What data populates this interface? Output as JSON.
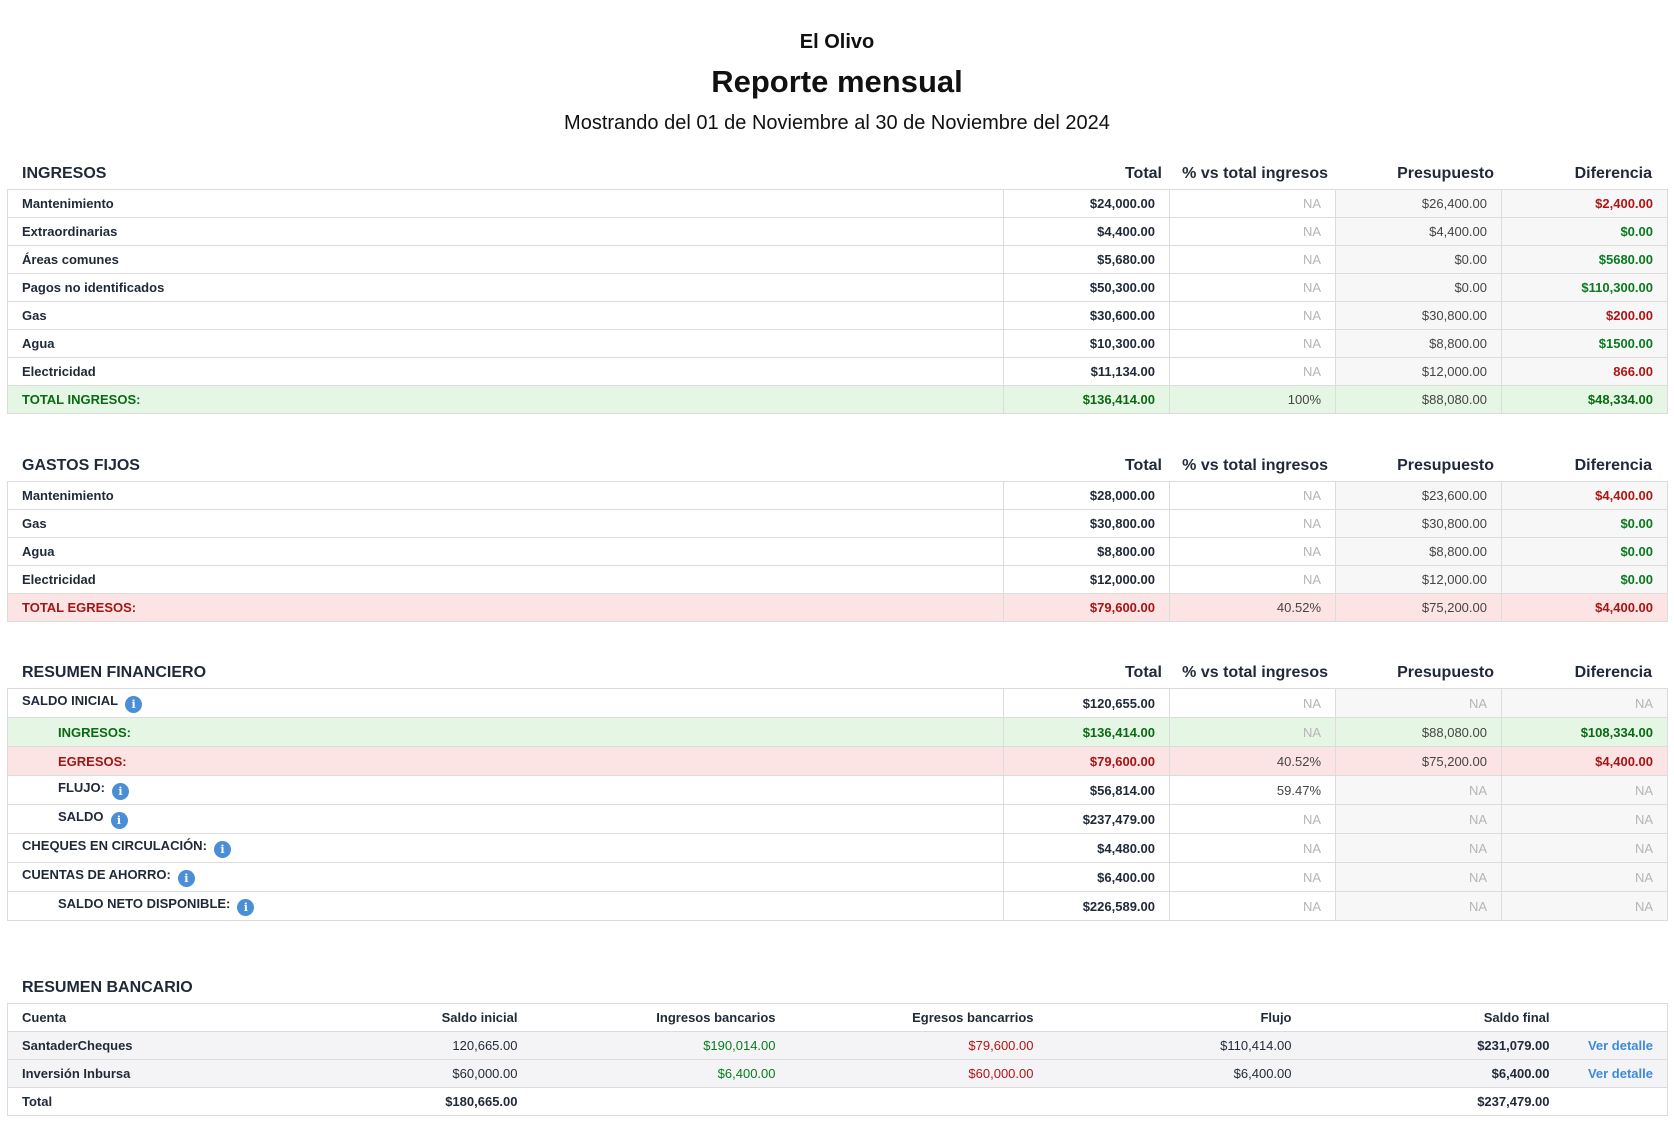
{
  "header": {
    "org": "El Olivo",
    "title": "Reporte mensual",
    "subtitle": "Mostrando del 01 de Noviembre al 30 de Noviembre del 2024"
  },
  "columns": {
    "total": "Total",
    "pct": "% vs total ingresos",
    "presupuesto": "Presupuesto",
    "diferencia": "Diferencia"
  },
  "ingresos": {
    "title": "INGRESOS",
    "rows": [
      {
        "label": "Mantenimiento",
        "total": "$24,000.00",
        "pct": "NA",
        "pres": "$26,400.00",
        "diff": "$2,400.00"
      },
      {
        "label": "Extraordinarias",
        "total": "$4,400.00",
        "pct": "NA",
        "pres": "$4,400.00",
        "diff": "$0.00"
      },
      {
        "label": "Áreas comunes",
        "total": "$5,680.00",
        "pct": "NA",
        "pres": "$0.00",
        "diff": "$5680.00"
      },
      {
        "label": "Pagos no identificados",
        "total": "$50,300.00",
        "pct": "NA",
        "pres": "$0.00",
        "diff": "$110,300.00"
      },
      {
        "label": "Gas",
        "total": "$30,600.00",
        "pct": "NA",
        "pres": "$30,800.00",
        "diff": "$200.00"
      },
      {
        "label": "Agua",
        "total": "$10,300.00",
        "pct": "NA",
        "pres": "$8,800.00",
        "diff": "$1500.00"
      },
      {
        "label": "Electricidad",
        "total": "$11,134.00",
        "pct": "NA",
        "pres": "$12,000.00",
        "diff": "866.00"
      }
    ],
    "total": {
      "label": "TOTAL INGRESOS:",
      "total": "$136,414.00",
      "pct": "100%",
      "pres": "$88,080.00",
      "diff": "$48,334.00"
    }
  },
  "gastos": {
    "title": "GASTOS FIJOS",
    "rows": [
      {
        "label": "Mantenimiento",
        "total": "$28,000.00",
        "pct": "NA",
        "pres": "$23,600.00",
        "diff": "$4,400.00"
      },
      {
        "label": "Gas",
        "total": "$30,800.00",
        "pct": "NA",
        "pres": "$30,800.00",
        "diff": "$0.00"
      },
      {
        "label": "Agua",
        "total": "$8,800.00",
        "pct": "NA",
        "pres": "$8,800.00",
        "diff": "$0.00"
      },
      {
        "label": "Electricidad",
        "total": "$12,000.00",
        "pct": "NA",
        "pres": "$12,000.00",
        "diff": "$0.00"
      }
    ],
    "total": {
      "label": "TOTAL EGRESOS:",
      "total": "$79,600.00",
      "pct": "40.52%",
      "pres": "$75,200.00",
      "diff": "$4,400.00"
    }
  },
  "resumen": {
    "title": "RESUMEN FINANCIERO",
    "rows": [
      {
        "label": "SALDO INICIAL",
        "total": "$120,655.00",
        "pct": "NA",
        "pres": "NA",
        "diff": "NA"
      },
      {
        "label": "INGRESOS:",
        "total": "$136,414.00",
        "pct": "NA",
        "pres": "$88,080.00",
        "diff": "$108,334.00"
      },
      {
        "label": "EGRESOS:",
        "total": "$79,600.00",
        "pct": "40.52%",
        "pres": "$75,200.00",
        "diff": "$4,400.00"
      },
      {
        "label": "FLUJO:",
        "total": "$56,814.00",
        "pct": "59.47%",
        "pres": "NA",
        "diff": "NA"
      },
      {
        "label": "SALDO",
        "total": "$237,479.00",
        "pct": "NA",
        "pres": "NA",
        "diff": "NA"
      },
      {
        "label": "CHEQUES EN CIRCULACIÓN:",
        "total": "$4,480.00",
        "pct": "NA",
        "pres": "NA",
        "diff": "NA"
      },
      {
        "label": "CUENTAS DE AHORRO:",
        "total": "$6,400.00",
        "pct": "NA",
        "pres": "NA",
        "diff": "NA"
      },
      {
        "label": "SALDO NETO DISPONIBLE:",
        "total": "$226,589.00",
        "pct": "NA",
        "pres": "NA",
        "diff": "NA"
      }
    ]
  },
  "bancario": {
    "title": "RESUMEN BANCARIO",
    "headers": {
      "cuenta": "Cuenta",
      "saldo_inicial": "Saldo inicial",
      "ingresos": "Ingresos bancarios",
      "egresos": "Egresos bancarrios",
      "flujo": "Flujo",
      "saldo_final": "Saldo final"
    },
    "rows": [
      {
        "cuenta": "SantaderCheques",
        "saldo_inicial": "120,665.00",
        "ingresos": "$190,014.00",
        "egresos": "$79,600.00",
        "flujo": "$110,414.00",
        "saldo_final": "$231,079.00",
        "link": "Ver detalle"
      },
      {
        "cuenta": "Inversión Inbursa",
        "saldo_inicial": "$60,000.00",
        "ingresos": "$6,400.00",
        "egresos": "$60,000.00",
        "flujo": "$6,400.00",
        "saldo_final": "$6,400.00",
        "link": "Ver detalle"
      }
    ],
    "total": {
      "label": "Total",
      "saldo_inicial": "$180,665.00",
      "saldo_final": "$237,479.00"
    }
  },
  "info_icon_glyph": "i",
  "colors": {
    "positive": "#0a7a1e",
    "negative": "#b01515",
    "link": "#3d8ad8",
    "info": "#4a8fd6"
  }
}
